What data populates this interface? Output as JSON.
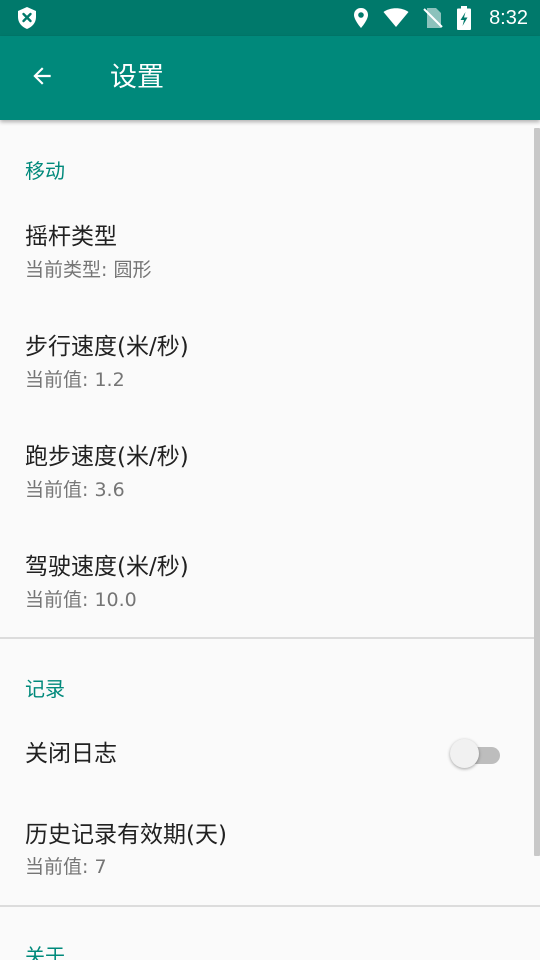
{
  "status_bar": {
    "time": "8:32",
    "icons": [
      "shield-x-icon",
      "location-icon",
      "wifi-icon",
      "no-sim-icon",
      "battery-charging-icon"
    ]
  },
  "app_bar": {
    "title": "设置",
    "back_icon": "arrow-back-icon"
  },
  "colors": {
    "status_bar": "#00796b",
    "app_bar": "#00897b",
    "accent": "#00897b",
    "background": "#fafafa"
  },
  "sections": {
    "movement": {
      "header": "移动",
      "joystick": {
        "title": "摇杆类型",
        "summary": "当前类型: 圆形"
      },
      "walk_speed": {
        "title": "步行速度(米/秒)",
        "summary": "当前值: 1.2"
      },
      "run_speed": {
        "title": "跑步速度(米/秒)",
        "summary": "当前值: 3.6"
      },
      "drive_speed": {
        "title": "驾驶速度(米/秒)",
        "summary": "当前值: 10.0"
      }
    },
    "record": {
      "header": "记录",
      "close_log": {
        "title": "关闭日志",
        "checked": false
      },
      "history_validity": {
        "title": "历史记录有效期(天)",
        "summary": "当前值: 7"
      }
    },
    "about": {
      "header": "关于"
    }
  }
}
